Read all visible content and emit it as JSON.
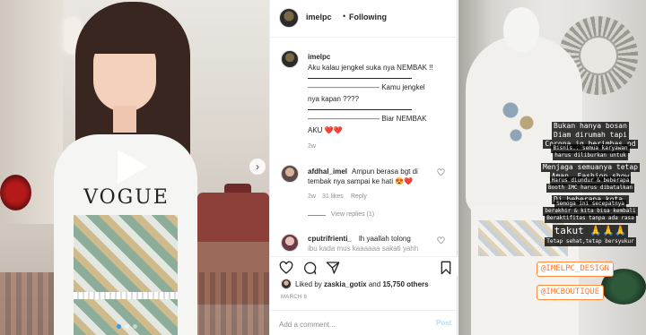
{
  "post": {
    "username": "imelpc",
    "header_separator": "•",
    "follow_status": "Following",
    "caption": {
      "username": "imelpc",
      "lines": [
        "Aku kalau jengkel suka nya NEMBAK !!",
        "—————————— Kamu jengkel",
        "nya kapan ????",
        "—————————— Biar NEMBAK",
        "AKU ❤️❤️"
      ],
      "time": "2w"
    },
    "comments": [
      {
        "username": "afdhal_imel",
        "text_line1": "Ampun berasa bgt di",
        "text_line2": "tembak nya sampai ke hati 😍❤️",
        "time": "2w",
        "likes": "31 likes",
        "reply": "Reply",
        "view_replies": "View replies (1)"
      },
      {
        "username": "cputrifrienti_",
        "text_line1": "lh yaallah tolong",
        "text_line2": "ibu kada mus kaaaaaa sakati yahh"
      }
    ],
    "liked_by": {
      "prefix": "Liked by",
      "user": "zaskia_gotix",
      "and": "and",
      "count": "15,750 others"
    },
    "date": "MARCH 6",
    "comment_placeholder": "Add a comment...",
    "post_label": "Post"
  },
  "video": {
    "shirt_text": "VOGUE",
    "carousel_next": "›",
    "carousel_dots": 3
  },
  "story": {
    "lines_big": [
      "Bukan hanya bosan",
      "Diam dirumah tapi",
      "Corona jg berimbas pd"
    ],
    "lines_small1": [
      "Bisnis.. semua karyawan",
      "harus diliburkan untuk"
    ],
    "lines_big2": [
      "Menjaga semuanya tetap",
      "Aman, Fashion show"
    ],
    "lines_small2": [
      "Harus diundur & beberapa",
      "Booth IMC harus dibatalkan"
    ],
    "lines_big3": [
      "Di beberapa kota."
    ],
    "lines_small3": [
      "Semoga ini secepatnya",
      "berakhir & kita bisa kembali",
      "Beraktifitas tanpa ada rasa"
    ],
    "takut": "takut 🙏🙏🙏",
    "closing": "Tetap sehat,tetap bersyukur",
    "tag1": "@IMELPC_DESIGN",
    "tag2": "@IMCBOUTIQUE"
  },
  "colors": {
    "accent_blue": "#3797f0",
    "tag_orange": "#ff7a2a",
    "post_disabled": "#b2dffc"
  },
  "icons": [
    "play-icon",
    "heart-icon",
    "comment-icon",
    "share-icon",
    "bookmark-icon",
    "chevron-right-icon"
  ]
}
